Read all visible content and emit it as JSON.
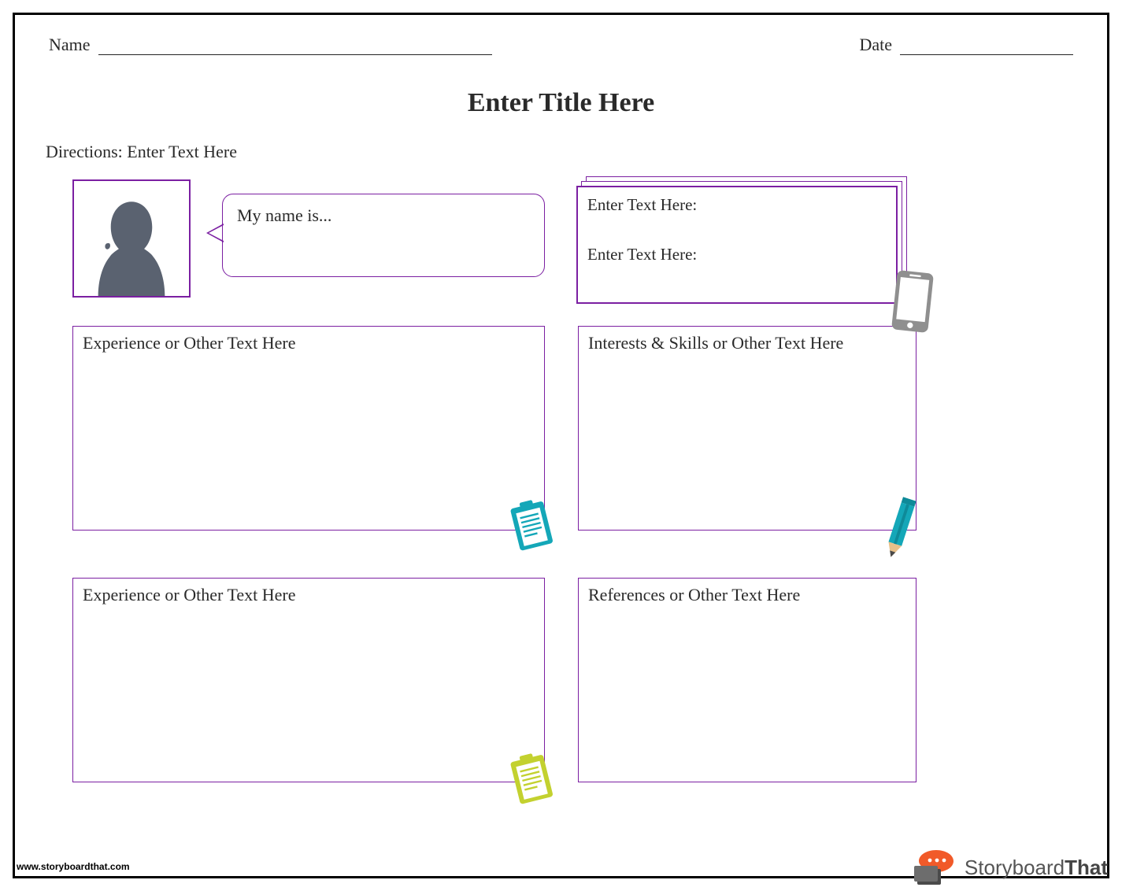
{
  "header": {
    "name_label": "Name",
    "date_label": "Date"
  },
  "title": "Enter Title Here",
  "directions": "Directions: Enter Text Here",
  "speech": "My name is...",
  "contact": {
    "line1": "Enter Text Here:",
    "line2": "Enter Text Here:"
  },
  "boxes": {
    "experience1": "Experience or Other Text Here",
    "interests": "Interests & Skills or Other Text Here",
    "experience2": "Experience or Other Text Here",
    "references": "References or Other Text Here"
  },
  "footer_url": "www.storyboardthat.com",
  "brand": {
    "thin": "Storyboard",
    "bold": "That"
  },
  "colors": {
    "purple": "#7b1fa2",
    "teal": "#14a7b8",
    "lime": "#c3d12f",
    "orange": "#f15a29",
    "gray": "#8f8f8f",
    "dark": "#4a4a4a"
  }
}
